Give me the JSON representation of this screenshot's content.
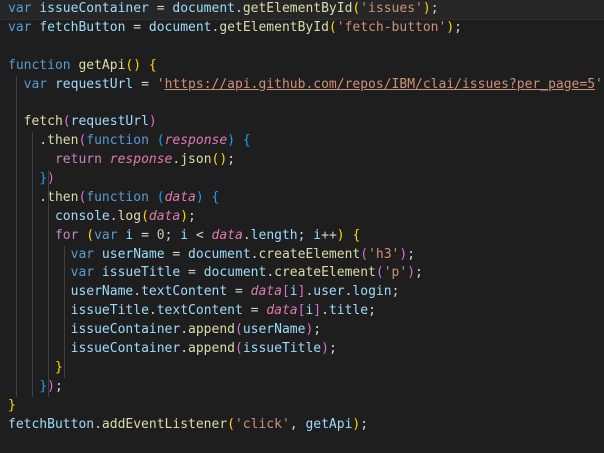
{
  "editor": {
    "language": "javascript",
    "lines": [
      {
        "tokens": [
          [
            "var ",
            "kw"
          ],
          [
            "issueContainer",
            "var"
          ],
          [
            " = ",
            "p"
          ],
          [
            "document",
            "var"
          ],
          [
            ".",
            "p"
          ],
          [
            "getElementById",
            "fn"
          ],
          [
            "(",
            "br1"
          ],
          [
            "'issues'",
            "str"
          ],
          [
            ")",
            "br1"
          ],
          [
            ";",
            "p"
          ]
        ]
      },
      {
        "tokens": [
          [
            "var ",
            "kw"
          ],
          [
            "fetchButton",
            "var"
          ],
          [
            " = ",
            "p"
          ],
          [
            "document",
            "var"
          ],
          [
            ".",
            "p"
          ],
          [
            "getElementById",
            "fn"
          ],
          [
            "(",
            "br1"
          ],
          [
            "'fetch-button'",
            "str"
          ],
          [
            ")",
            "br1"
          ],
          [
            ";",
            "p"
          ]
        ]
      },
      {
        "tokens": []
      },
      {
        "tokens": [
          [
            "function ",
            "kw"
          ],
          [
            "getApi",
            "fn"
          ],
          [
            "()",
            "br1"
          ],
          [
            " ",
            "p"
          ],
          [
            "{",
            "br1"
          ]
        ]
      },
      {
        "tokens": [
          [
            "  var ",
            "kw"
          ],
          [
            "requestUrl",
            "var"
          ],
          [
            " = ",
            "p"
          ],
          [
            "'",
            "str"
          ],
          [
            "https://api.github.com/repos/IBM/clai/issues?per_page=5",
            "str lnk"
          ],
          [
            "';",
            "str"
          ]
        ]
      },
      {
        "tokens": []
      },
      {
        "tokens": [
          [
            "  ",
            "p"
          ],
          [
            "fetch",
            "fn"
          ],
          [
            "(",
            "br2"
          ],
          [
            "requestUrl",
            "var"
          ],
          [
            ")",
            "br2"
          ]
        ]
      },
      {
        "tokens": [
          [
            "    .",
            "p"
          ],
          [
            "then",
            "fn"
          ],
          [
            "(",
            "br2"
          ],
          [
            "function ",
            "kw"
          ],
          [
            "(",
            "br3"
          ],
          [
            "response",
            "param"
          ],
          [
            ")",
            "br3"
          ],
          [
            " ",
            "p"
          ],
          [
            "{",
            "br3"
          ]
        ]
      },
      {
        "tokens": [
          [
            "      ",
            "p"
          ],
          [
            "return ",
            "ctl"
          ],
          [
            "response",
            "param"
          ],
          [
            ".",
            "p"
          ],
          [
            "json",
            "fn"
          ],
          [
            "()",
            "br1"
          ],
          [
            ";",
            "p"
          ]
        ]
      },
      {
        "tokens": [
          [
            "    ",
            "p"
          ],
          [
            "}",
            "br3"
          ],
          [
            ")",
            "br2"
          ]
        ]
      },
      {
        "tokens": [
          [
            "    .",
            "p"
          ],
          [
            "then",
            "fn"
          ],
          [
            "(",
            "br2"
          ],
          [
            "function ",
            "kw"
          ],
          [
            "(",
            "br3"
          ],
          [
            "data",
            "param"
          ],
          [
            ")",
            "br3"
          ],
          [
            " ",
            "p"
          ],
          [
            "{",
            "br3"
          ]
        ]
      },
      {
        "tokens": [
          [
            "      ",
            "p"
          ],
          [
            "console",
            "var"
          ],
          [
            ".",
            "p"
          ],
          [
            "log",
            "fn"
          ],
          [
            "(",
            "br1"
          ],
          [
            "data",
            "param"
          ],
          [
            ")",
            "br1"
          ],
          [
            ";",
            "p"
          ]
        ]
      },
      {
        "tokens": [
          [
            "      ",
            "p"
          ],
          [
            "for ",
            "ctl"
          ],
          [
            "(",
            "br1"
          ],
          [
            "var ",
            "kw"
          ],
          [
            "i",
            "var"
          ],
          [
            " = ",
            "p"
          ],
          [
            "0",
            "num"
          ],
          [
            "; ",
            "p"
          ],
          [
            "i",
            "var"
          ],
          [
            " < ",
            "p"
          ],
          [
            "data",
            "param"
          ],
          [
            ".",
            "p"
          ],
          [
            "length",
            "var"
          ],
          [
            "; ",
            "p"
          ],
          [
            "i",
            "var"
          ],
          [
            "++",
            "p"
          ],
          [
            ")",
            "br1"
          ],
          [
            " ",
            "p"
          ],
          [
            "{",
            "br1"
          ]
        ]
      },
      {
        "tokens": [
          [
            "        var ",
            "kw"
          ],
          [
            "userName",
            "var"
          ],
          [
            " = ",
            "p"
          ],
          [
            "document",
            "var"
          ],
          [
            ".",
            "p"
          ],
          [
            "createElement",
            "fn"
          ],
          [
            "(",
            "br2"
          ],
          [
            "'h3'",
            "str"
          ],
          [
            ")",
            "br2"
          ],
          [
            ";",
            "p"
          ]
        ]
      },
      {
        "tokens": [
          [
            "        var ",
            "kw"
          ],
          [
            "issueTitle",
            "var"
          ],
          [
            " = ",
            "p"
          ],
          [
            "document",
            "var"
          ],
          [
            ".",
            "p"
          ],
          [
            "createElement",
            "fn"
          ],
          [
            "(",
            "br2"
          ],
          [
            "'p'",
            "str"
          ],
          [
            ")",
            "br2"
          ],
          [
            ";",
            "p"
          ]
        ]
      },
      {
        "tokens": [
          [
            "        ",
            "p"
          ],
          [
            "userName",
            "var"
          ],
          [
            ".",
            "p"
          ],
          [
            "textContent",
            "var"
          ],
          [
            " = ",
            "p"
          ],
          [
            "data",
            "param"
          ],
          [
            "[",
            "br2"
          ],
          [
            "i",
            "var"
          ],
          [
            "]",
            "br2"
          ],
          [
            ".",
            "p"
          ],
          [
            "user",
            "var"
          ],
          [
            ".",
            "p"
          ],
          [
            "login",
            "var"
          ],
          [
            ";",
            "p"
          ]
        ]
      },
      {
        "tokens": [
          [
            "        ",
            "p"
          ],
          [
            "issueTitle",
            "var"
          ],
          [
            ".",
            "p"
          ],
          [
            "textContent",
            "var"
          ],
          [
            " = ",
            "p"
          ],
          [
            "data",
            "param"
          ],
          [
            "[",
            "br2"
          ],
          [
            "i",
            "var"
          ],
          [
            "]",
            "br2"
          ],
          [
            ".",
            "p"
          ],
          [
            "title",
            "var"
          ],
          [
            ";",
            "p"
          ]
        ]
      },
      {
        "tokens": [
          [
            "        ",
            "p"
          ],
          [
            "issueContainer",
            "var"
          ],
          [
            ".",
            "p"
          ],
          [
            "append",
            "fn"
          ],
          [
            "(",
            "br2"
          ],
          [
            "userName",
            "var"
          ],
          [
            ")",
            "br2"
          ],
          [
            ";",
            "p"
          ]
        ]
      },
      {
        "tokens": [
          [
            "        ",
            "p"
          ],
          [
            "issueContainer",
            "var"
          ],
          [
            ".",
            "p"
          ],
          [
            "append",
            "fn"
          ],
          [
            "(",
            "br2"
          ],
          [
            "issueTitle",
            "var"
          ],
          [
            ")",
            "br2"
          ],
          [
            ";",
            "p"
          ]
        ]
      },
      {
        "tokens": [
          [
            "      ",
            "p"
          ],
          [
            "}",
            "br1"
          ]
        ]
      },
      {
        "tokens": [
          [
            "    ",
            "p"
          ],
          [
            "}",
            "br3"
          ],
          [
            ")",
            "br2"
          ],
          [
            ";",
            "p"
          ]
        ]
      },
      {
        "tokens": [
          [
            "}",
            "br1"
          ]
        ]
      },
      {
        "tokens": [
          [
            "fetchButton",
            "var"
          ],
          [
            ".",
            "p"
          ],
          [
            "addEventListener",
            "fn"
          ],
          [
            "(",
            "br1"
          ],
          [
            "'click'",
            "str"
          ],
          [
            ", ",
            "p"
          ],
          [
            "getApi",
            "var"
          ],
          [
            ")",
            "br1"
          ],
          [
            ";",
            "p"
          ]
        ]
      }
    ]
  }
}
